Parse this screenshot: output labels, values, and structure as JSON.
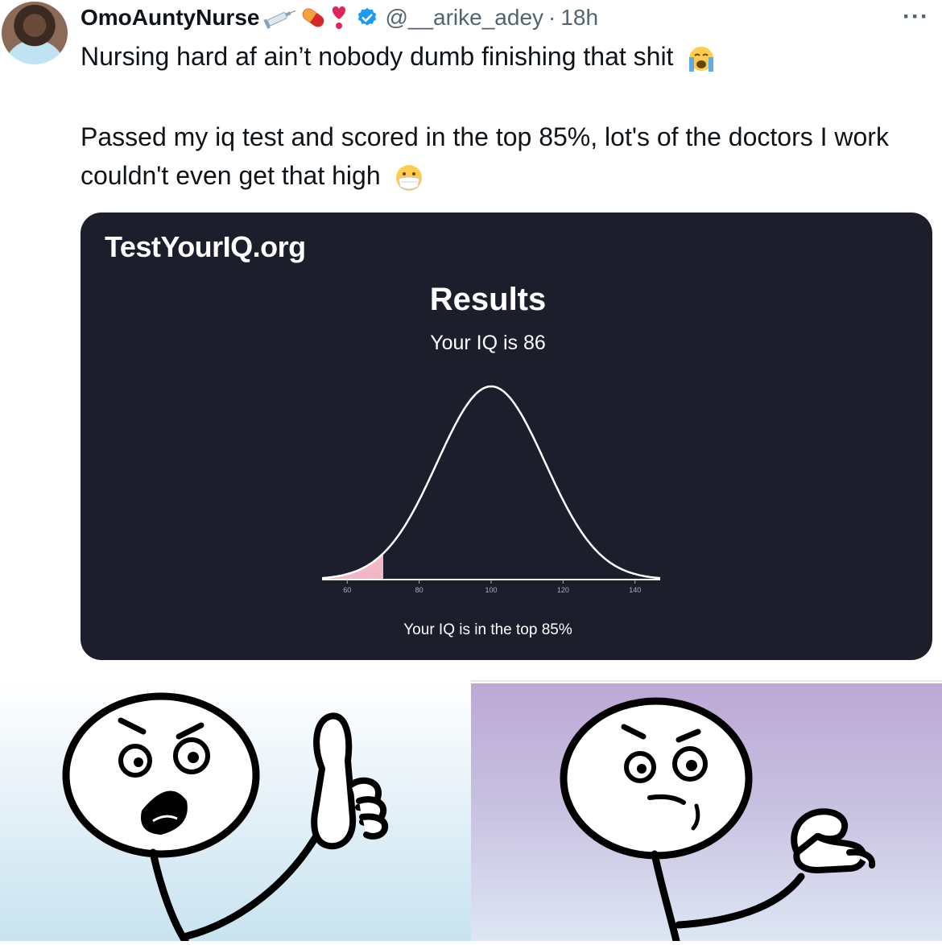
{
  "tweet": {
    "display_name": "OmoAuntyNurse",
    "name_emojis": [
      "syringe-icon",
      "pill-icon",
      "heart-exclamation-icon"
    ],
    "handle": "@__arike_adey",
    "separator": "·",
    "time": "18h",
    "more": "···",
    "text_line1": "Nursing hard af ain’t nobody dumb finishing that shit",
    "text_line1_emoji": "crying-face-icon",
    "text_line2": "Passed my iq test and scored in the top 85%, lot's of the doctors I work couldn't even get that high",
    "text_line2_emoji": "face-with-mask-icon"
  },
  "card": {
    "brand": "TestYourIQ.org",
    "results_title": "Results",
    "results_sub": "Your IQ is 86",
    "footer": "Your IQ is in the top 85%",
    "colors": {
      "background": "#1c1e2b",
      "curve": "#ffffff",
      "shade": "#f2b8c6"
    }
  },
  "chart_data": {
    "type": "area",
    "distribution": "normal",
    "mean": 100,
    "sd": 15,
    "xlim": [
      53,
      147
    ],
    "x_ticks": [
      60,
      80,
      100,
      120,
      140
    ],
    "x_tick_labels": [
      "60",
      "80",
      "100",
      "120",
      "140"
    ],
    "shaded_range": [
      53,
      70
    ],
    "score": 86,
    "grid": false
  },
  "meme": {
    "left_panel": "stick-figure-raising-finger",
    "right_panel": "stick-figure-pondering-finger-lowered",
    "colors": {
      "left_bg": "#d6ebf5",
      "right_bg": "#c3b3dc"
    }
  }
}
